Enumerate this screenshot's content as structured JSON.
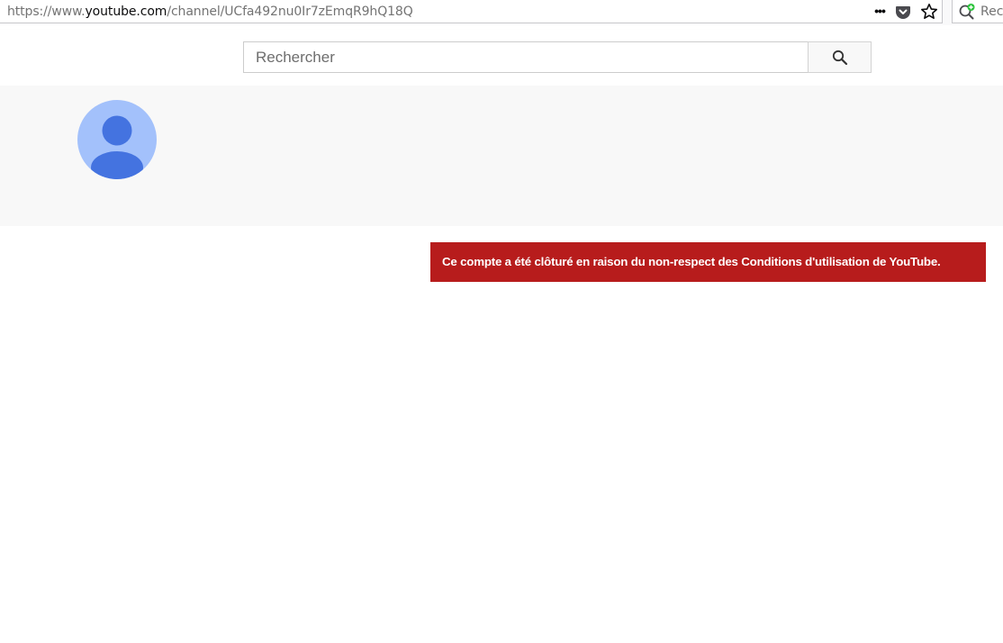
{
  "browser": {
    "url_prefix": "https://www.",
    "url_host": "youtube.com",
    "url_path": "/channel/UCfa492nu0Ir7zEmqR9hQ18Q",
    "menu_dots": "•••",
    "search_text": "Rech",
    "icons": [
      "page-actions-icon",
      "pocket-icon",
      "bookmark-star-icon",
      "search-engine-icon"
    ]
  },
  "masthead": {
    "search_placeholder": "Rechercher",
    "search_button_icon": "search-icon"
  },
  "channel": {
    "avatar_icon": "default-avatar-icon",
    "avatar_bg": "#a3c1fb",
    "avatar_fg": "#4473e0"
  },
  "alert": {
    "message": "Ce compte a été clôturé en raison du non-respect des Conditions d'utilisation de YouTube.",
    "color": "#b71c1c"
  }
}
